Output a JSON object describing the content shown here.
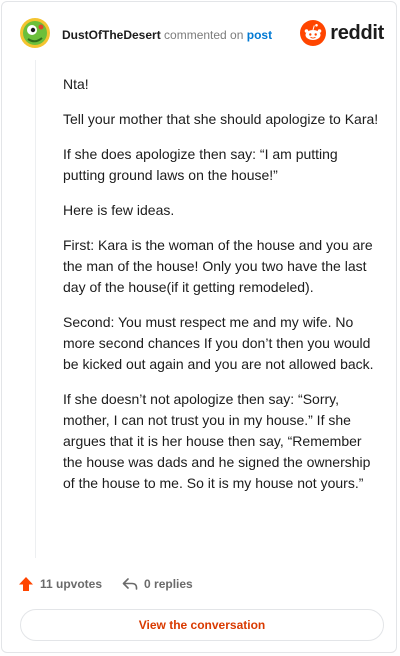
{
  "header": {
    "author": "DustOfTheDesert",
    "action_text": " commented on ",
    "post_link_label": "post",
    "brand": "reddit"
  },
  "comment": {
    "paragraphs": [
      "Nta!",
      "Tell your mother that she should apologize to Kara!",
      "If she does apologize then say: “I am putting putting ground laws on the house!”",
      "Here is few ideas.",
      "First: Kara is the woman of the house and you are the man of the house! Only you two have the last day of the house(if it getting remodeled).",
      "Second: You must respect me and my wife. No more second chances If you don’t then you would be kicked out again and you are not allowed back.",
      "If she doesn’t not apologize then say: “Sorry, mother, I can not trust you in my house.” If she argues that it is her house then say, “Remember the house was dads and he signed the ownership of the house to me. So it is my house not yours.”"
    ]
  },
  "actions": {
    "upvotes": "11 upvotes",
    "replies": "0 replies"
  },
  "cta_label": "View the conversation",
  "colors": {
    "accent": "#ff4500",
    "link": "#0079d3",
    "cta_text": "#d93a00"
  }
}
